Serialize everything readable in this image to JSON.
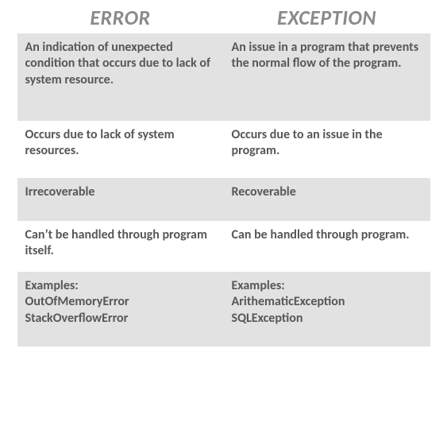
{
  "headers": {
    "col1": "ERROR",
    "col2": "EXCEPTION"
  },
  "rows": [
    {
      "col1": "An indication of unexpected condition that occurs due to lack of system resource.",
      "col2": "An issue in a program that prevents the normal flow of the program."
    },
    {
      "col1": "Occurs due to lack of system resources.",
      "col2": "Occurs due to an issue in the program."
    },
    {
      "col1": "Irrecoverable",
      "col2": "Recoverable"
    },
    {
      "col1": "Can’t be handled through program itself.",
      "col2": "Can be handled through program."
    },
    {
      "col1": "Examples:\nOutOfMemoryError\nStackOverflowError",
      "col2": "Examples:\nArithematicException\nSQLException"
    }
  ]
}
